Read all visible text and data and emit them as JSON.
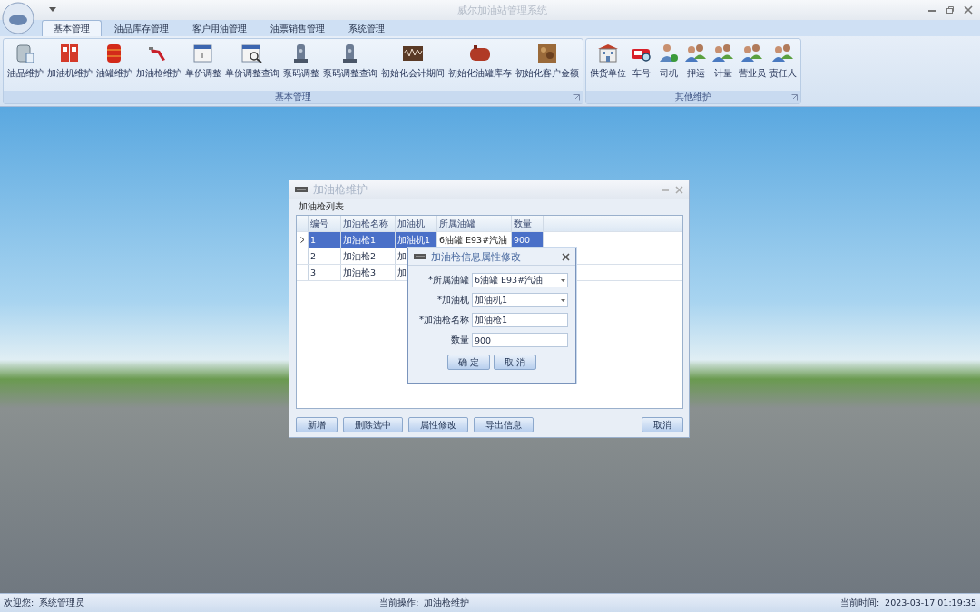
{
  "window": {
    "title": "威尔加油站管理系统"
  },
  "tabs": [
    {
      "label": "基本管理",
      "selected": true
    },
    {
      "label": "油品库存管理",
      "selected": false
    },
    {
      "label": "客户用油管理",
      "selected": false
    },
    {
      "label": "油票销售管理",
      "selected": false
    },
    {
      "label": "系统管理",
      "selected": false
    }
  ],
  "ribbon_groups": [
    {
      "title": "基本管理",
      "items": [
        {
          "label": "油品维护"
        },
        {
          "label": "加油机维护"
        },
        {
          "label": "油罐维护"
        },
        {
          "label": "加油枪维护"
        },
        {
          "label": "单价调整"
        },
        {
          "label": "单价调整查询"
        },
        {
          "label": "泵码调整"
        },
        {
          "label": "泵码调整查询"
        },
        {
          "label": "初始化会计期间"
        },
        {
          "label": "初始化油罐库存"
        },
        {
          "label": "初始化客户金额"
        }
      ]
    },
    {
      "title": "其他维护",
      "items": [
        {
          "label": "供货单位"
        },
        {
          "label": "车号"
        },
        {
          "label": "司机"
        },
        {
          "label": "押运"
        },
        {
          "label": "计量"
        },
        {
          "label": "营业员"
        },
        {
          "label": "责任人"
        }
      ]
    }
  ],
  "main_dialog": {
    "title": "加油枪维护",
    "list_title": "加油枪列表",
    "columns": [
      "编号",
      "加油枪名称",
      "加油机",
      "所属油罐",
      "数量"
    ],
    "rows": [
      {
        "selected": true,
        "cells": [
          "1",
          "加油枪1",
          "加油机1",
          "6油罐 E93#汽油",
          "900"
        ]
      },
      {
        "selected": false,
        "cells": [
          "2",
          "加油枪2",
          "加"
        ]
      },
      {
        "selected": false,
        "cells": [
          "3",
          "加油枪3",
          "加"
        ]
      }
    ],
    "buttons": [
      "新增",
      "删除选中",
      "属性修改",
      "导出信息"
    ],
    "cancel_button": "取消"
  },
  "edit_dialog": {
    "title": "加油枪信息属性修改",
    "fields": [
      {
        "label": "*所属油罐",
        "kind": "select",
        "value": "6油罐 E93#汽油"
      },
      {
        "label": "*加油机",
        "kind": "select",
        "value": "加油机1"
      },
      {
        "label": "*加油枪名称",
        "kind": "text",
        "value": "加油枪1"
      },
      {
        "label": "数量",
        "kind": "text",
        "value": "900"
      }
    ],
    "buttons": [
      "确 定",
      "取 消"
    ]
  },
  "status_bar": {
    "user_label": "欢迎您:",
    "user": "系统管理员",
    "operation_label": "当前操作:",
    "operation": "加油枪维护",
    "time_label": "当前时间:",
    "time": "2023-03-17 01:19:35"
  }
}
